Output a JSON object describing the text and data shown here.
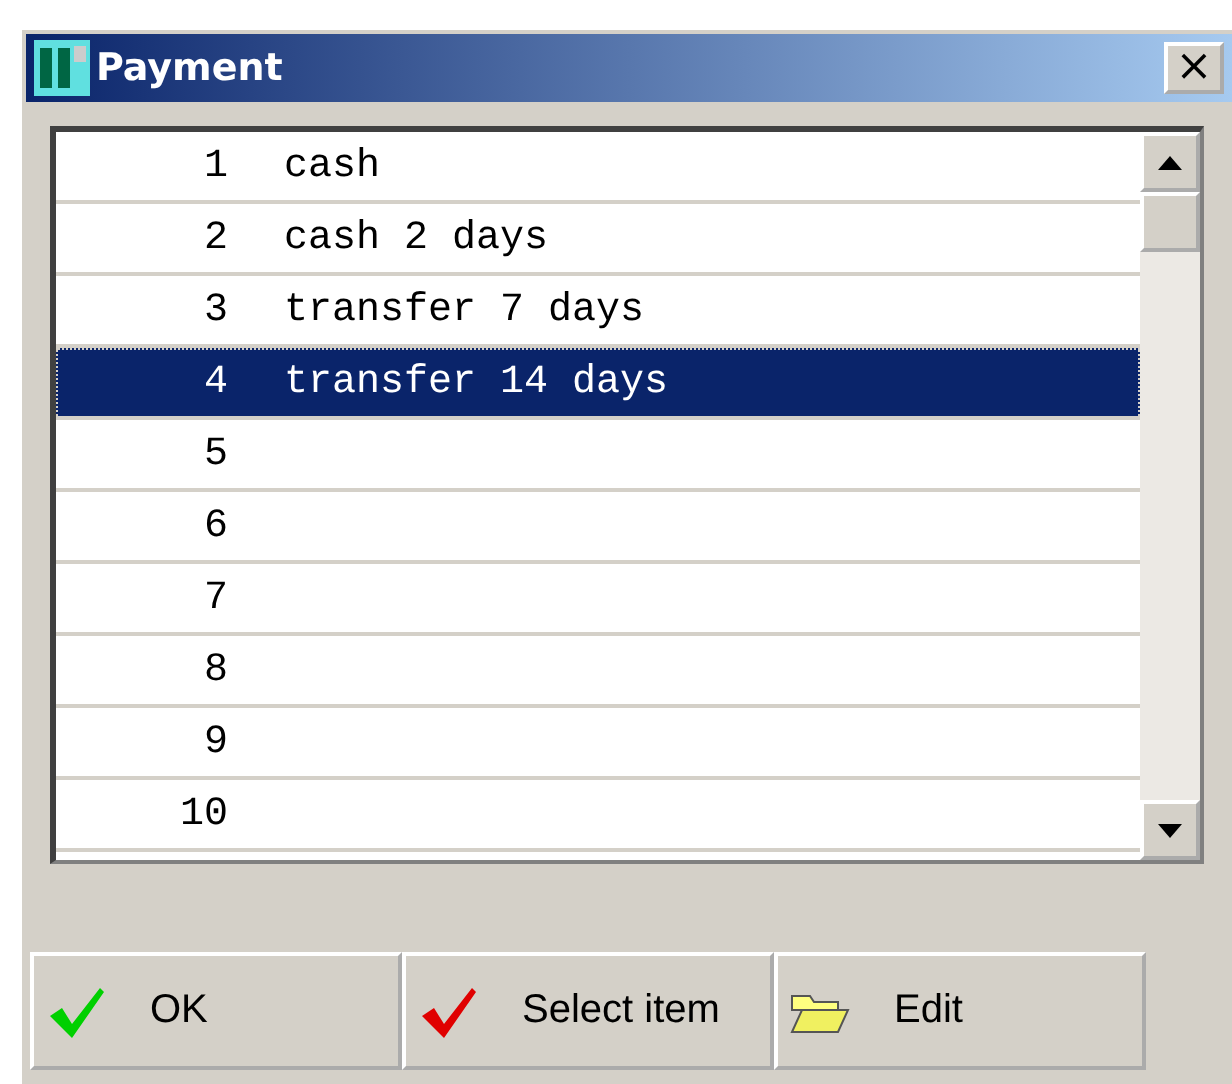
{
  "window": {
    "title": "Payment",
    "close": "×"
  },
  "list": {
    "rows": [
      {
        "number": "1",
        "name": "cash",
        "selected": false
      },
      {
        "number": "2",
        "name": "cash 2 days",
        "selected": false
      },
      {
        "number": "3",
        "name": "transfer 7 days",
        "selected": false
      },
      {
        "number": "4",
        "name": "transfer 14 days",
        "selected": true
      },
      {
        "number": "5",
        "name": "",
        "selected": false
      },
      {
        "number": "6",
        "name": "",
        "selected": false
      },
      {
        "number": "7",
        "name": "",
        "selected": false
      },
      {
        "number": "8",
        "name": "",
        "selected": false
      },
      {
        "number": "9",
        "name": "",
        "selected": false
      },
      {
        "number": "10",
        "name": "",
        "selected": false
      }
    ]
  },
  "buttons": [
    {
      "kind": "ok",
      "label": "OK"
    },
    {
      "kind": "select",
      "label": "Select item"
    },
    {
      "kind": "edit",
      "label": "Edit"
    }
  ]
}
